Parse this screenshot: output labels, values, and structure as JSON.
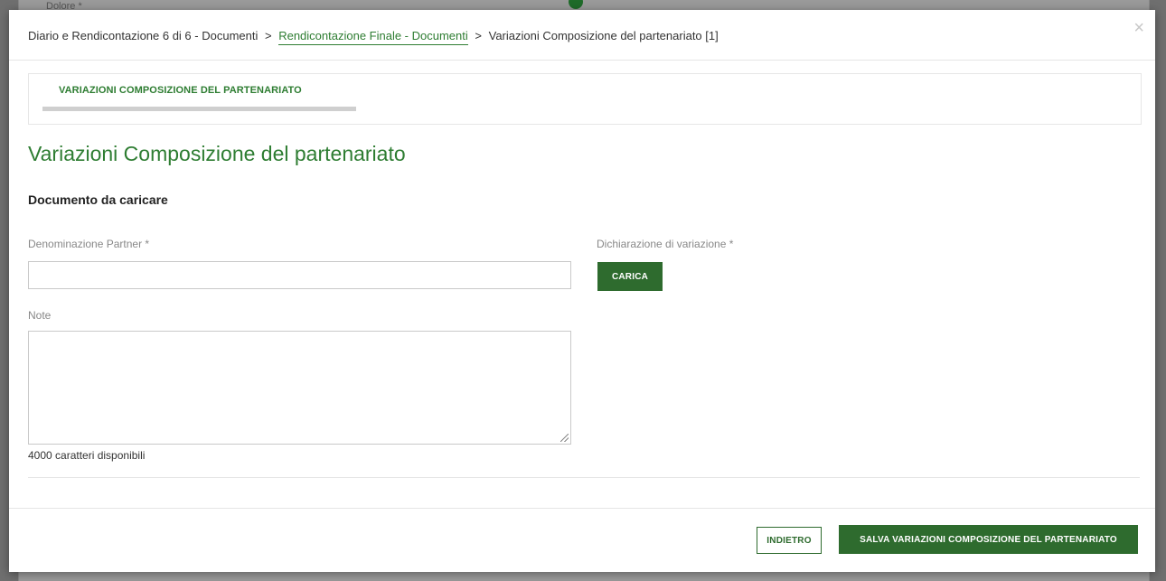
{
  "background": {
    "ghost_text": "Dolore *"
  },
  "breadcrumb": {
    "item1": "Diario e Rendicontazione 6 di 6 - Documenti",
    "sep1": ">",
    "item2": "Rendicontazione Finale - Documenti",
    "sep2": ">",
    "item3": "Variazioni Composizione del partenariato [1]"
  },
  "close_label": "×",
  "tabs": [
    {
      "label": "VARIAZIONI COMPOSIZIONE DEL PARTENARIATO"
    }
  ],
  "page_title": "Variazioni Composizione del partenariato",
  "section_title": "Documento da caricare",
  "form": {
    "partner_label": "Denominazione Partner *",
    "partner_value": "",
    "declaration_label": "Dichiarazione di variazione *",
    "upload_button": "CARICA",
    "note_label": "Note",
    "note_value": "",
    "char_count": "4000 caratteri disponibili"
  },
  "footer": {
    "back_button": "INDIETRO",
    "save_button": "SALVA VARIAZIONI COMPOSIZIONE DEL PARTENARIATO"
  },
  "colors": {
    "accent": "#2e7d32",
    "button": "#2e6b2e"
  }
}
